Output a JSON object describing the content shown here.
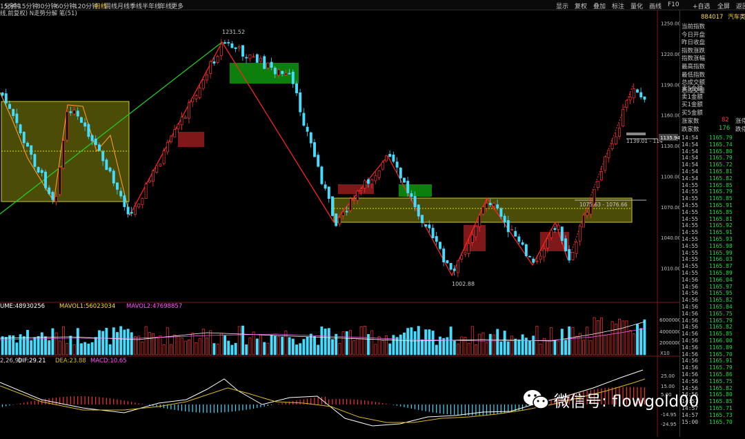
{
  "toolbar": {
    "timeframes": [
      "1分钟",
      "5分钟",
      "15分钟",
      "30分钟",
      "60分钟",
      "120分钟",
      "日线",
      "周线",
      "月线",
      "季线",
      "半年线",
      "年线",
      "更多"
    ],
    "active_timeframe": "日线",
    "right_buttons": [
      "显示",
      "复权",
      "叠加",
      "标注",
      "量化",
      "画线",
      "F10",
      "+自选",
      "全屏",
      "返回"
    ]
  },
  "chart": {
    "indicator_label": "线,前复权) N走势分解 笔(51)",
    "annotations": {
      "high": "1231.52",
      "low": "1002.88",
      "zone_label": "1075.63 - 1076.66",
      "right_label": "1139.01 - 114",
      "price_tag": "1135.94"
    },
    "volume_legend": {
      "volume": "UME:48930256",
      "mavol1": "MAVOL1:56023034",
      "mavol2": "MAVOL2:47698857"
    },
    "macd_legend": {
      "params": "2,26,9)",
      "dif": "DIF:29.21",
      "dea": "DEA:23.88",
      "macd": "MACD:10.65"
    },
    "vol_unit": "X10",
    "colors": {
      "up": "#ff3333",
      "down": "#44ddff",
      "yellow": "#dddd00",
      "green_line": "#22cc22",
      "white_line": "#ffffff"
    }
  },
  "chart_data": {
    "type": "candlestick",
    "y_ticks_price": [
      "1250.00",
      "1220.00",
      "1190.00",
      "1160.00",
      "1130.00",
      "1100.00",
      "1070.00",
      "1040.00",
      "1010.00"
    ],
    "y_ticks_volume": [
      "6000000",
      "4000000",
      "2000000"
    ],
    "y_ticks_macd": [
      "25.00",
      "15.00",
      "5.00",
      "-14.95",
      "-24.95"
    ],
    "key_points": [
      {
        "label": "high",
        "value": 1231.52
      },
      {
        "label": "low",
        "value": 1002.88
      }
    ]
  },
  "right_panel": {
    "header_code": "884017",
    "header_name": "汽车类",
    "fields": [
      "当前指数",
      "今日开盘",
      "昨日收盘",
      "指数涨跌",
      "指数涨幅",
      "最高指数",
      "最低指数",
      "总成交额",
      "总成交量"
    ],
    "order_fields": [
      "卖5金额",
      "卖1金额",
      "买1金额",
      "买5金额"
    ],
    "rise_label": "涨家数",
    "rise_value": "82",
    "rise_extra": "涨停",
    "fall_label": "跌家数",
    "fall_value": "176",
    "fall_extra": "跌停",
    "ticks": [
      {
        "t": "14:54",
        "p": "1165.79"
      },
      {
        "t": "14:54",
        "p": "1165.74"
      },
      {
        "t": "14:54",
        "p": "1165.80"
      },
      {
        "t": "14:54",
        "p": "1165.79"
      },
      {
        "t": "14:54",
        "p": "1165.72"
      },
      {
        "t": "14:54",
        "p": "1165.81"
      },
      {
        "t": "14:54",
        "p": "1165.82"
      },
      {
        "t": "14:55",
        "p": "1165.85"
      },
      {
        "t": "14:55",
        "p": "1165.79"
      },
      {
        "t": "14:55",
        "p": "1165.85"
      },
      {
        "t": "14:55",
        "p": "1165.91"
      },
      {
        "t": "14:55",
        "p": "1165.85"
      },
      {
        "t": "14:55",
        "p": "1165.81"
      },
      {
        "t": "14:55",
        "p": "1165.92"
      },
      {
        "t": "14:55",
        "p": "1165.91"
      },
      {
        "t": "14:55",
        "p": "1165.93"
      },
      {
        "t": "14:55",
        "p": "1165.98"
      },
      {
        "t": "14:55",
        "p": "1165.99"
      },
      {
        "t": "14:55",
        "p": "1166.03"
      },
      {
        "t": "14:55",
        "p": "1165.87"
      },
      {
        "t": "14:55",
        "p": "1165.89"
      },
      {
        "t": "14:56",
        "p": "1166.04"
      },
      {
        "t": "14:56",
        "p": "1165.97"
      },
      {
        "t": "14:56",
        "p": "1165.95"
      },
      {
        "t": "14:56",
        "p": "1165.82"
      },
      {
        "t": "14:56",
        "p": "1165.84"
      },
      {
        "t": "14:56",
        "p": "1165.75"
      },
      {
        "t": "14:56",
        "p": "1165.79"
      },
      {
        "t": "14:56",
        "p": "1165.82"
      },
      {
        "t": "14:56",
        "p": "1165.85"
      },
      {
        "t": "14:56",
        "p": "1166.00"
      },
      {
        "t": "14:56",
        "p": "1165.89"
      },
      {
        "t": "14:56",
        "p": "1165.70"
      },
      {
        "t": "14:56",
        "p": "1165.91"
      },
      {
        "t": "14:56",
        "p": "1165.79"
      },
      {
        "t": "14:56",
        "p": "1165.86"
      },
      {
        "t": "14:56",
        "p": "1165.75"
      },
      {
        "t": "14:56",
        "p": "1165.82"
      },
      {
        "t": "14:56",
        "p": "1165.80"
      },
      {
        "t": "14:57",
        "p": "1165.85"
      },
      {
        "t": "14:57",
        "p": "1165.71"
      },
      {
        "t": "14:57",
        "p": "1165.73"
      },
      {
        "t": "15:00",
        "p": "1165.70"
      }
    ]
  },
  "watermark": {
    "text": "微信号: flowgold00"
  }
}
